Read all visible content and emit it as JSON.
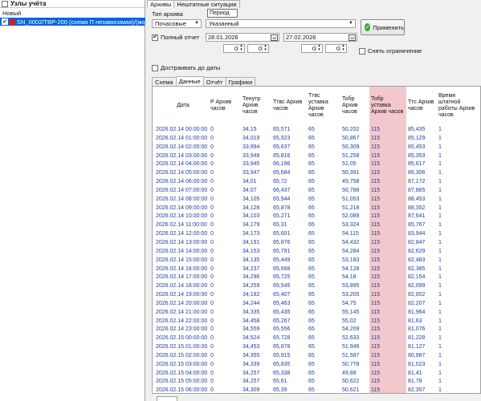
{
  "left": {
    "header": "Узлы учёта",
    "group_label": "Новый",
    "node_label": "SN_0002/ТВР-200 (схема П независимая)/(модуль 90"
  },
  "tabs": [
    "Архивы",
    "Нештатные ситуации"
  ],
  "archive": {
    "type_label": "Тип архива",
    "period_button": "Период",
    "type_select": "Почасовые",
    "mode_select": "Указанный",
    "apply_label": "Применить"
  },
  "full_report": {
    "label": "Полный отчет",
    "checked": true,
    "date_from": "28.01.2026",
    "date_to": "27.02.2026",
    "from_hour": "0",
    "from_min": "0",
    "to_hour": "0",
    "to_min": "0",
    "remove_limit": "Снять ограничение",
    "append_label": "Достраивать до даты"
  },
  "data_tabs": [
    "Схема",
    "Данные",
    "Отчёт",
    "Графики"
  ],
  "grid": {
    "headers": [
      "Дата",
      "P Архив часов",
      "Тенутр Архив часов",
      "Ттвс Архив часов",
      "Ттвс уставка Архив часов",
      "Тобр Архив часов",
      "Тобр уставка Архив часов",
      "Ттс Архив часов",
      "Время штатной работы Архив часов"
    ],
    "rows": [
      [
        "2026.02.14 00:00:00",
        "0",
        "34,15",
        "65,571",
        "65",
        "50,202",
        "115",
        "85,435",
        "1"
      ],
      [
        "2026.02.14 01:00:00",
        "0",
        "34,019",
        "65,923",
        "65",
        "50,867",
        "115",
        "85,129",
        "1"
      ],
      [
        "2026.02.14 02:00:00",
        "0",
        "33,994",
        "65,637",
        "65",
        "50,309",
        "115",
        "85,453",
        "1"
      ],
      [
        "2026.02.14 03:00:00",
        "0",
        "33,948",
        "65,816",
        "65",
        "51,258",
        "115",
        "85,353",
        "1"
      ],
      [
        "2026.02.14 04:00:00",
        "0",
        "33,945",
        "66,196",
        "65",
        "51,05",
        "115",
        "85,617",
        "1"
      ],
      [
        "2026.02.14 05:00:00",
        "0",
        "33,947",
        "65,684",
        "65",
        "50,391",
        "115",
        "86,306",
        "1"
      ],
      [
        "2026.02.14 06:00:00",
        "0",
        "34,01",
        "65,72",
        "65",
        "49,758",
        "115",
        "87,172",
        "1"
      ],
      [
        "2026.02.14 07:00:00",
        "0",
        "34,07",
        "66,437",
        "65",
        "50,788",
        "115",
        "87,865",
        "1"
      ],
      [
        "2026.02.14 08:00:00",
        "0",
        "34,105",
        "65,944",
        "65",
        "51,053",
        "115",
        "88,453",
        "1"
      ],
      [
        "2026.02.14 09:00:00",
        "0",
        "34,128",
        "65,878",
        "65",
        "51,218",
        "115",
        "88,352",
        "1"
      ],
      [
        "2026.02.14 10:00:00",
        "0",
        "34,103",
        "65,271",
        "65",
        "52,089",
        "115",
        "87,641",
        "1"
      ],
      [
        "2026.02.14 11:00:00",
        "0",
        "34,179",
        "65,31",
        "65",
        "53,324",
        "115",
        "85,767",
        "1"
      ],
      [
        "2026.02.14 12:00:00",
        "0",
        "34,173",
        "65,601",
        "65",
        "54,115",
        "115",
        "83,944",
        "1"
      ],
      [
        "2026.02.14 13:00:00",
        "0",
        "34,191",
        "65,876",
        "65",
        "54,432",
        "115",
        "82,847",
        "1"
      ],
      [
        "2026.02.14 14:00:00",
        "0",
        "34,153",
        "65,791",
        "65",
        "54,284",
        "115",
        "82,629",
        "1"
      ],
      [
        "2026.02.14 15:00:00",
        "0",
        "34,135",
        "65,449",
        "65",
        "53,183",
        "115",
        "82,483",
        "1"
      ],
      [
        "2026.02.14 16:00:00",
        "0",
        "34,237",
        "65,668",
        "65",
        "54,128",
        "115",
        "82,385",
        "1"
      ],
      [
        "2026.02.14 17:00:00",
        "0",
        "34,296",
        "65,725",
        "65",
        "54,18",
        "115",
        "82,154",
        "1"
      ],
      [
        "2026.02.14 18:00:00",
        "0",
        "34,259",
        "65,545",
        "65",
        "53,895",
        "115",
        "82,099",
        "1"
      ],
      [
        "2026.02.14 19:00:00",
        "0",
        "34,182",
        "65,407",
        "65",
        "53,205",
        "115",
        "82,002",
        "1"
      ],
      [
        "2026.02.14 20:00:00",
        "0",
        "34,244",
        "65,463",
        "65",
        "54,75",
        "115",
        "82,207",
        "1"
      ],
      [
        "2026.02.14 21:00:00",
        "0",
        "34,335",
        "65,435",
        "65",
        "55,145",
        "115",
        "81,964",
        "1"
      ],
      [
        "2026.02.14 22:00:00",
        "0",
        "34,458",
        "65,267",
        "65",
        "55,02",
        "115",
        "81,63",
        "1"
      ],
      [
        "2026.02.14 23:00:00",
        "0",
        "34,559",
        "65,556",
        "65",
        "54,209",
        "115",
        "81,076",
        "1"
      ],
      [
        "2026.02.15 00:00:00",
        "0",
        "34,524",
        "65,728",
        "65",
        "52,633",
        "115",
        "81,228",
        "1"
      ],
      [
        "2026.02.15 01:00:00",
        "0",
        "34,453",
        "65,878",
        "65",
        "51,949",
        "115",
        "81,127",
        "1"
      ],
      [
        "2026.02.15 02:00:00",
        "0",
        "34,355",
        "65,915",
        "65",
        "51,587",
        "115",
        "80,987",
        "1"
      ],
      [
        "2026.02.15 03:00:00",
        "0",
        "34,339",
        "65,835",
        "65",
        "50,778",
        "115",
        "81,023",
        "1"
      ],
      [
        "2026.02.15 04:00:00",
        "0",
        "34,257",
        "65,338",
        "65",
        "49,88",
        "115",
        "81,41",
        "1"
      ],
      [
        "2026.02.15 05:00:00",
        "0",
        "34,257",
        "65,61",
        "65",
        "50,622",
        "115",
        "81,78",
        "1"
      ],
      [
        "2026.02.15 06:00:00",
        "0",
        "34,309",
        "65,39",
        "65",
        "50,621",
        "115",
        "82,357",
        "1"
      ]
    ]
  }
}
